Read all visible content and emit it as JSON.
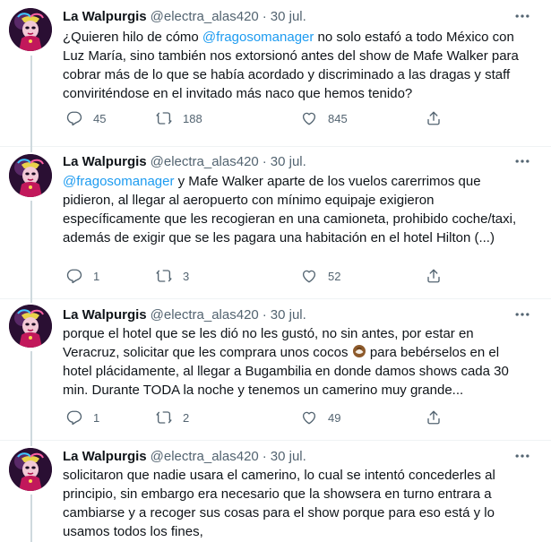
{
  "tweets": [
    {
      "name": "La Walpurgis",
      "handle": "@electra_alas420",
      "separator": "·",
      "date": "30 jul.",
      "text_parts": [
        "¿Quieren hilo de cómo ",
        "@fragosomanager",
        " no solo estafó a todo México con Luz María, sino también nos extorsionó antes del show de Mafe Walker para cobrar más de lo que se había acordado y discriminado a las dragas y staff conviriténdose en el invitado más naco que hemos tenido?"
      ],
      "replies": "45",
      "retweets": "188",
      "likes": "845"
    },
    {
      "name": "La Walpurgis",
      "handle": "@electra_alas420",
      "separator": "·",
      "date": "30 jul.",
      "text_parts": [
        "@fragosomanager",
        " y Mafe Walker aparte de los vuelos carerrimos que pidieron, al llegar al aeropuerto con mínimo equipaje exigieron específicamente que les recogieran en una camioneta, prohibido coche/taxi, además de exigir que se les pagara una habitación en el hotel Hilton (...)"
      ],
      "replies": "1",
      "retweets": "3",
      "likes": "52"
    },
    {
      "name": "La Walpurgis",
      "handle": "@electra_alas420",
      "separator": "·",
      "date": "30 jul.",
      "text_parts": [
        "porque el hotel que se les dió no les gustó, no sin antes, por estar en Veracruz, solicitar que les comprara unos cocos ",
        " para bebérselos en el hotel plácidamente, al llegar a Bugambilia en donde damos shows cada 30 min. Durante TODA la noche y tenemos un camerino muy grande..."
      ],
      "replies": "1",
      "retweets": "2",
      "likes": "49"
    },
    {
      "name": "La Walpurgis",
      "handle": "@electra_alas420",
      "separator": "·",
      "date": "30 jul.",
      "text_parts": [
        "solicitaron que nadie usara el camerino, lo cual se intentó concederles al principio, sin embargo era necesario que la showsera en turno entrara a cambiarse y a recoger sus cosas para el show porque para eso está y lo usamos todos los fines,"
      ]
    }
  ],
  "colors": {
    "accent": "#1d9bf0",
    "text": "#0f1419",
    "muted": "#536471",
    "divider": "#eff3f4",
    "thread_line": "#cfd9de"
  },
  "icons": {
    "more": "more-horizontal-icon",
    "reply": "reply-icon",
    "retweet": "retweet-icon",
    "like": "heart-icon",
    "share": "share-icon",
    "emoji": "coconut-emoji"
  }
}
